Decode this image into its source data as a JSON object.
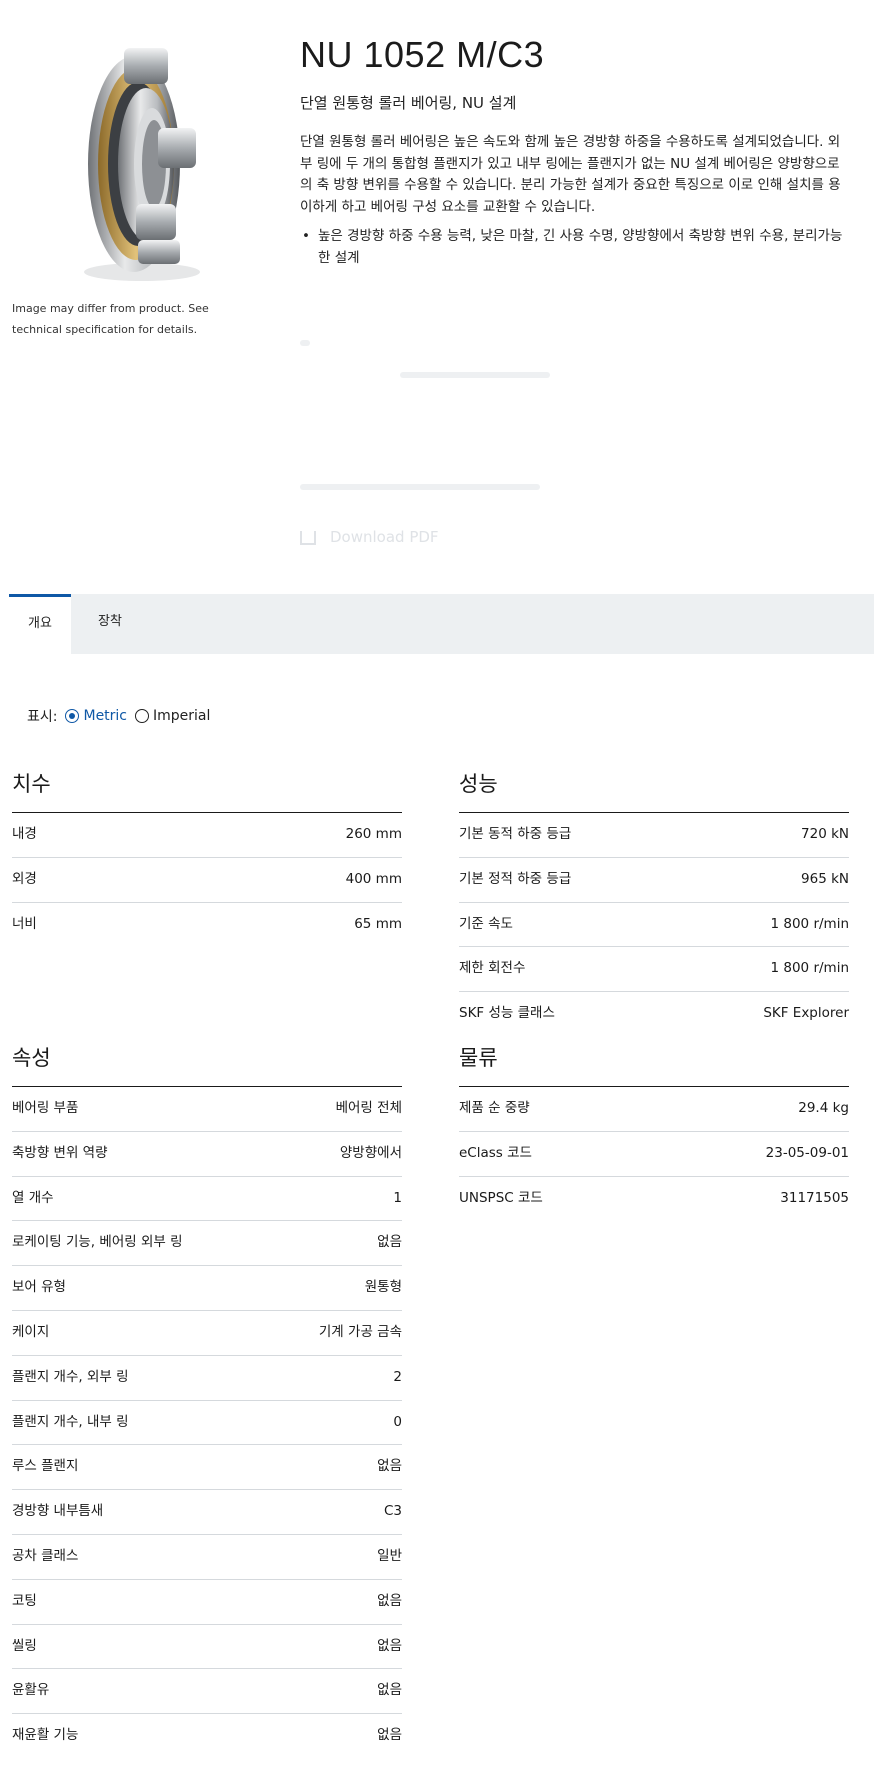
{
  "image_disclaimer": "Image may differ from product. See technical specification for details.",
  "product": {
    "title": "NU 1052 M/C3",
    "subtitle": "단열 원통형 롤러 베어링, NU 설계",
    "description": "단열 원통형 롤러 베어링은 높은 속도와 함께 높은 경방향 하중을 수용하도록 설계되었습니다. 외부 링에 두 개의 통합형 플랜지가 있고 내부 링에는 플랜지가 없는 NU 설계 베어링은 양방향으로의 축 방향 변위를 수용할 수 있습니다. 분리 가능한 설계가 중요한 특징으로 이로 인해 설치를 용이하게 하고 베어링 구성 요소를 교환할 수 있습니다.",
    "features": [
      "높은 경방향 하중 수용 능력, 낮은 마찰, 긴 사용 수명, 양방향에서 축방향 변위 수용, 분리가능한 설계"
    ]
  },
  "download_label": "Download PDF",
  "tabs": [
    "개요",
    "장착"
  ],
  "units": {
    "label": "표시:",
    "options": [
      "Metric",
      "Imperial"
    ],
    "selected": "Metric"
  },
  "sections": {
    "dimensions": {
      "title": "치수",
      "rows": [
        {
          "label": "내경",
          "value": "260 mm"
        },
        {
          "label": "외경",
          "value": "400 mm"
        },
        {
          "label": "너비",
          "value": "65 mm"
        }
      ]
    },
    "performance": {
      "title": "성능",
      "rows": [
        {
          "label": "기본 동적 하중 등급",
          "value": "720 kN"
        },
        {
          "label": "기본 정적 하중 등급",
          "value": "965 kN"
        },
        {
          "label": "기준 속도",
          "value": "1 800 r/min"
        },
        {
          "label": "제한 회전수",
          "value": "1 800 r/min"
        },
        {
          "label": "SKF 성능 클래스",
          "value": "SKF Explorer"
        }
      ]
    },
    "properties": {
      "title": "속성",
      "rows": [
        {
          "label": "베어링 부품",
          "value": "베어링 전체"
        },
        {
          "label": "축방향 변위 역량",
          "value": "양방향에서"
        },
        {
          "label": "열 개수",
          "value": "1"
        },
        {
          "label": "로케이팅 기능, 베어링 외부 링",
          "value": "없음"
        },
        {
          "label": "보어 유형",
          "value": "원통형"
        },
        {
          "label": "케이지",
          "value": "기계 가공 금속"
        },
        {
          "label": "플랜지 개수, 외부 링",
          "value": "2"
        },
        {
          "label": "플랜지 개수, 내부 링",
          "value": "0"
        },
        {
          "label": "루스 플랜지",
          "value": "없음"
        },
        {
          "label": "경방향 내부틈새",
          "value": "C3"
        },
        {
          "label": "공차 클래스",
          "value": "일반"
        },
        {
          "label": "코팅",
          "value": "없음"
        },
        {
          "label": "씰링",
          "value": "없음"
        },
        {
          "label": "윤활유",
          "value": "없음"
        },
        {
          "label": "재윤활 기능",
          "value": "없음"
        }
      ]
    },
    "logistics": {
      "title": "물류",
      "rows": [
        {
          "label": "제품 순 중량",
          "value": "29.4 kg"
        },
        {
          "label": "eClass 코드",
          "value": "23-05-09-01"
        },
        {
          "label": "UNSPSC 코드",
          "value": "31171505"
        }
      ]
    }
  },
  "colors": {
    "accent": "#0f58a6",
    "tab_bar": "#edf0f2",
    "brass_cage": "#c9a34a"
  }
}
